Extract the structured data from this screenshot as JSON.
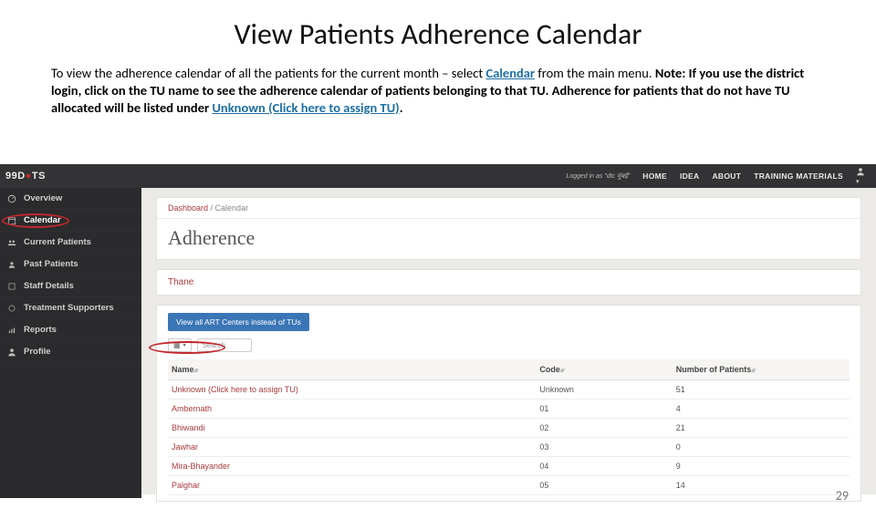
{
  "slide": {
    "title": "View Patients Adherence Calendar",
    "body_pre": "To view the adherence calendar of all the patients for the current month – select ",
    "body_link1": "Calendar",
    "body_mid": " from the main menu. ",
    "note_label": "Note:",
    "note_text": " If you use the district login, click on the TU name to see the adherence calendar of patients belonging to that TU. Adherence for patients that do not have TU allocated will be listed under ",
    "body_link2": "Unknown (Click here to assign TU)",
    "period": ".",
    "page_number": "29"
  },
  "topnav": {
    "brand_prefix": "99D",
    "brand_suffix": "TS",
    "logged": "Logged in as \"dtc मुंबई\"",
    "links": [
      "HOME",
      "IDEA",
      "ABOUT",
      "TRAINING MATERIALS"
    ]
  },
  "sidebar": {
    "items": [
      {
        "label": "Overview"
      },
      {
        "label": "Calendar"
      },
      {
        "label": "Current Patients"
      },
      {
        "label": "Past Patients"
      },
      {
        "label": "Staff Details"
      },
      {
        "label": "Treatment Supporters"
      },
      {
        "label": "Reports"
      },
      {
        "label": "Profile"
      }
    ]
  },
  "main": {
    "breadcrumb_root": "Dashboard",
    "breadcrumb_sep": " / ",
    "breadcrumb_current": "Calendar",
    "heading": "Adherence",
    "region": "Thane",
    "button": "View all ART Centers instead of TUs",
    "search_placeholder": "Search",
    "columns": {
      "name": "Name",
      "code": "Code",
      "num": "Number of Patients"
    },
    "rows": [
      {
        "name": "Unknown (Click here to assign TU)",
        "code": "Unknown",
        "num": "51"
      },
      {
        "name": "Ambernath",
        "code": "01",
        "num": "4"
      },
      {
        "name": "Bhiwandi",
        "code": "02",
        "num": "21"
      },
      {
        "name": "Jawhar",
        "code": "03",
        "num": "0"
      },
      {
        "name": "Mira-Bhayander",
        "code": "04",
        "num": "9"
      },
      {
        "name": "Palghar",
        "code": "05",
        "num": "14"
      }
    ]
  }
}
